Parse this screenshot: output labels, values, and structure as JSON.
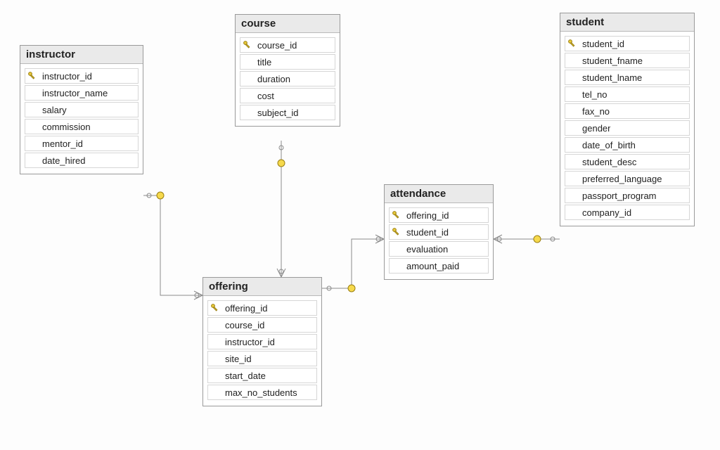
{
  "entities": {
    "instructor": {
      "title": "instructor",
      "columns": [
        {
          "name": "instructor_id",
          "pk": true
        },
        {
          "name": "instructor_name",
          "pk": false
        },
        {
          "name": "salary",
          "pk": false
        },
        {
          "name": "commission",
          "pk": false
        },
        {
          "name": "mentor_id",
          "pk": false
        },
        {
          "name": "date_hired",
          "pk": false
        }
      ]
    },
    "course": {
      "title": "course",
      "columns": [
        {
          "name": "course_id",
          "pk": true
        },
        {
          "name": "title",
          "pk": false
        },
        {
          "name": "duration",
          "pk": false
        },
        {
          "name": "cost",
          "pk": false
        },
        {
          "name": "subject_id",
          "pk": false
        }
      ]
    },
    "offering": {
      "title": "offering",
      "columns": [
        {
          "name": "offering_id",
          "pk": true
        },
        {
          "name": "course_id",
          "pk": false
        },
        {
          "name": "instructor_id",
          "pk": false
        },
        {
          "name": "site_id",
          "pk": false
        },
        {
          "name": "start_date",
          "pk": false
        },
        {
          "name": "max_no_students",
          "pk": false
        }
      ]
    },
    "attendance": {
      "title": "attendance",
      "columns": [
        {
          "name": "offering_id",
          "pk": true
        },
        {
          "name": "student_id",
          "pk": true
        },
        {
          "name": "evaluation",
          "pk": false
        },
        {
          "name": "amount_paid",
          "pk": false
        }
      ]
    },
    "student": {
      "title": "student",
      "columns": [
        {
          "name": "student_id",
          "pk": true
        },
        {
          "name": "student_fname",
          "pk": false
        },
        {
          "name": "student_lname",
          "pk": false
        },
        {
          "name": "tel_no",
          "pk": false
        },
        {
          "name": "fax_no",
          "pk": false
        },
        {
          "name": "gender",
          "pk": false
        },
        {
          "name": "date_of_birth",
          "pk": false
        },
        {
          "name": "student_desc",
          "pk": false
        },
        {
          "name": "preferred_language",
          "pk": false
        },
        {
          "name": "passport_program",
          "pk": false
        },
        {
          "name": "company_id",
          "pk": false
        }
      ]
    }
  },
  "relationships": [
    {
      "from": "instructor",
      "to": "offering",
      "via": "instructor_id"
    },
    {
      "from": "course",
      "to": "offering",
      "via": "course_id"
    },
    {
      "from": "offering",
      "to": "attendance",
      "via": "offering_id"
    },
    {
      "from": "student",
      "to": "attendance",
      "via": "student_id"
    }
  ]
}
